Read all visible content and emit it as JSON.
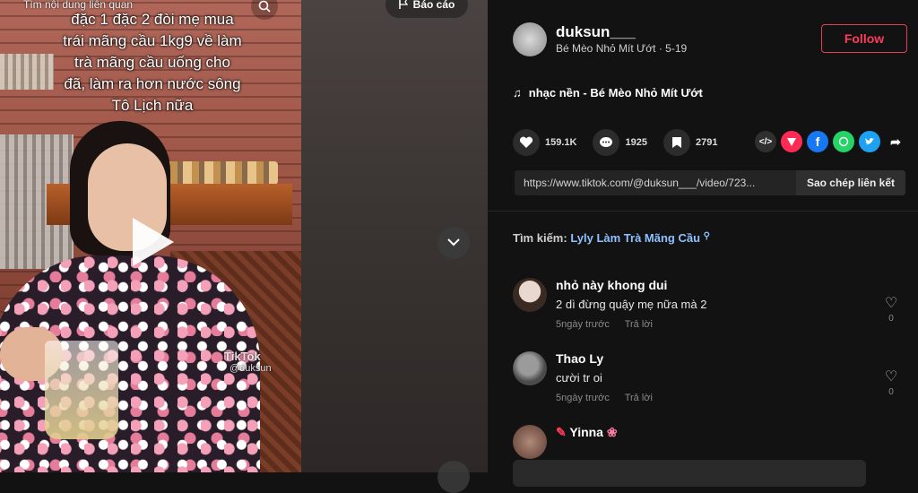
{
  "video": {
    "related_search": "Tìm nội dung liên quan",
    "caption_lines": [
      "đặc 1 đặc 2 đòi mẹ mua",
      "trái mãng cầu 1kg9 về làm",
      "trà mãng cầu uống cho",
      "đã, làm ra hơn nước sông",
      "Tô Lịch nữa"
    ],
    "watermark": "TikTok",
    "watermark_handle": "@duksun"
  },
  "middle": {
    "report_label": "Báo cáo"
  },
  "profile": {
    "username": "duksun___",
    "subline": "Bé Mèo Nhỏ Mít Ướt · 5-19",
    "follow_label": "Follow"
  },
  "music": {
    "icon": "music-note-icon",
    "label": "nhạc nền - Bé Mèo Nhỏ Mít Ướt"
  },
  "stats": {
    "likes": "159.1K",
    "comments": "1925",
    "saves": "2791"
  },
  "share": {
    "icons": [
      "embed-icon",
      "share-to-icon",
      "facebook-icon",
      "whatsapp-icon",
      "twitter-icon",
      "forward-icon"
    ]
  },
  "link": {
    "url": "https://www.tiktok.com/@duksun___/video/723...",
    "copy_label": "Sao chép liên kết"
  },
  "search": {
    "prefix": "Tìm kiếm:",
    "term": "Lyly Làm Trà Mãng Cầu"
  },
  "comments": [
    {
      "name": "nhỏ này khong dui",
      "text": "2 dì đừng quậy mẹ nữa mà 2",
      "time": "5ngày trước",
      "reply": "Trả lời",
      "likes": "0"
    },
    {
      "name": "Thao Ly",
      "text": "cười tr oi",
      "time": "5ngày trước",
      "reply": "Trả lời",
      "likes": "0"
    },
    {
      "name": "Yinna",
      "text": "",
      "time": "",
      "reply": "",
      "likes": ""
    }
  ],
  "colors": {
    "accent": "#ff3b5c",
    "background": "#121212",
    "search_term": "#8ec1ff"
  }
}
